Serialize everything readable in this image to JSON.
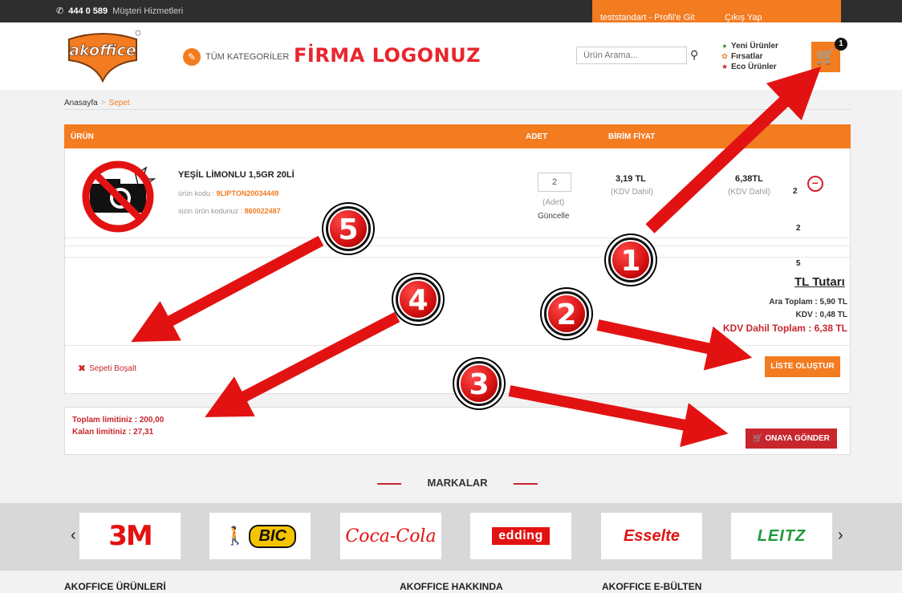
{
  "topbar": {
    "phone": "444 0 589",
    "service": "Müşteri Hizmetleri"
  },
  "userpanel": {
    "user_link": "teststandart - Profil'e Git",
    "logout": "Çıkış Yap"
  },
  "header": {
    "logo_text": "akoffice",
    "categories": "TÜM KATEGORİLER",
    "firm_logo": "FİRMA LOGONUZ",
    "search_placeholder": "Ürün Arama...",
    "quick_links": [
      "Yeni Ürünler",
      "Fırsatlar",
      "Eco Ürünler"
    ],
    "cart_count": "1"
  },
  "breadcrumb": {
    "home": "Anasayfa",
    "separator": ">",
    "current": "Sepet"
  },
  "cart": {
    "headers": {
      "product": "ÜRÜN",
      "qty": "ADET",
      "unit_price": "BİRİM FİYAT"
    },
    "item": {
      "name": "YEŞİL LİMONLU 1,5GR 20Lİ",
      "code_label": "ürün kodu :",
      "code": "9LIPTON20034449",
      "cust_code_label": "sizin ürün kodunuz :",
      "cust_code": "860022487",
      "qty": "2",
      "qty_unit": "(Adet)",
      "update": "Güncelle",
      "unit_price": "3,19 TL",
      "unit_price_note": "(KDV Dahil)",
      "total": "6,38TL",
      "total_note": "(KDV Dahil)",
      "count_a": "2",
      "count_b": "2",
      "count_c": "5"
    },
    "summary": {
      "title": "TL Tutarı",
      "subtotal": "Ara Toplam : 5,90 TL",
      "vat": "KDV : 0,48 TL",
      "grand_total": "KDV Dahil Toplam : 6,38 TL"
    },
    "empty_label": "Sepeti Boşalt",
    "list_button": "LİSTE OLUŞTUR"
  },
  "limits": {
    "total": "Toplam limitiniz : 200,00",
    "remaining": "Kalan limitiniz : 27,31",
    "approve_button": "ONAYA GÖNDER"
  },
  "brands": {
    "title": "MARKALAR",
    "items": [
      "3M",
      "BIC",
      "Coca-Cola",
      "edding",
      "Esselte",
      "LEITZ"
    ]
  },
  "footer": [
    "AKOFFICE ÜRÜNLERİ",
    "AKOFFICE HAKKINDA",
    "AKOFFICE E-BÜLTEN"
  ],
  "markers": [
    "1",
    "2",
    "3",
    "4",
    "5"
  ],
  "colors": {
    "brand_orange": "#f37b20",
    "accent_red": "#c8262d",
    "arrow_red": "#e31212"
  }
}
